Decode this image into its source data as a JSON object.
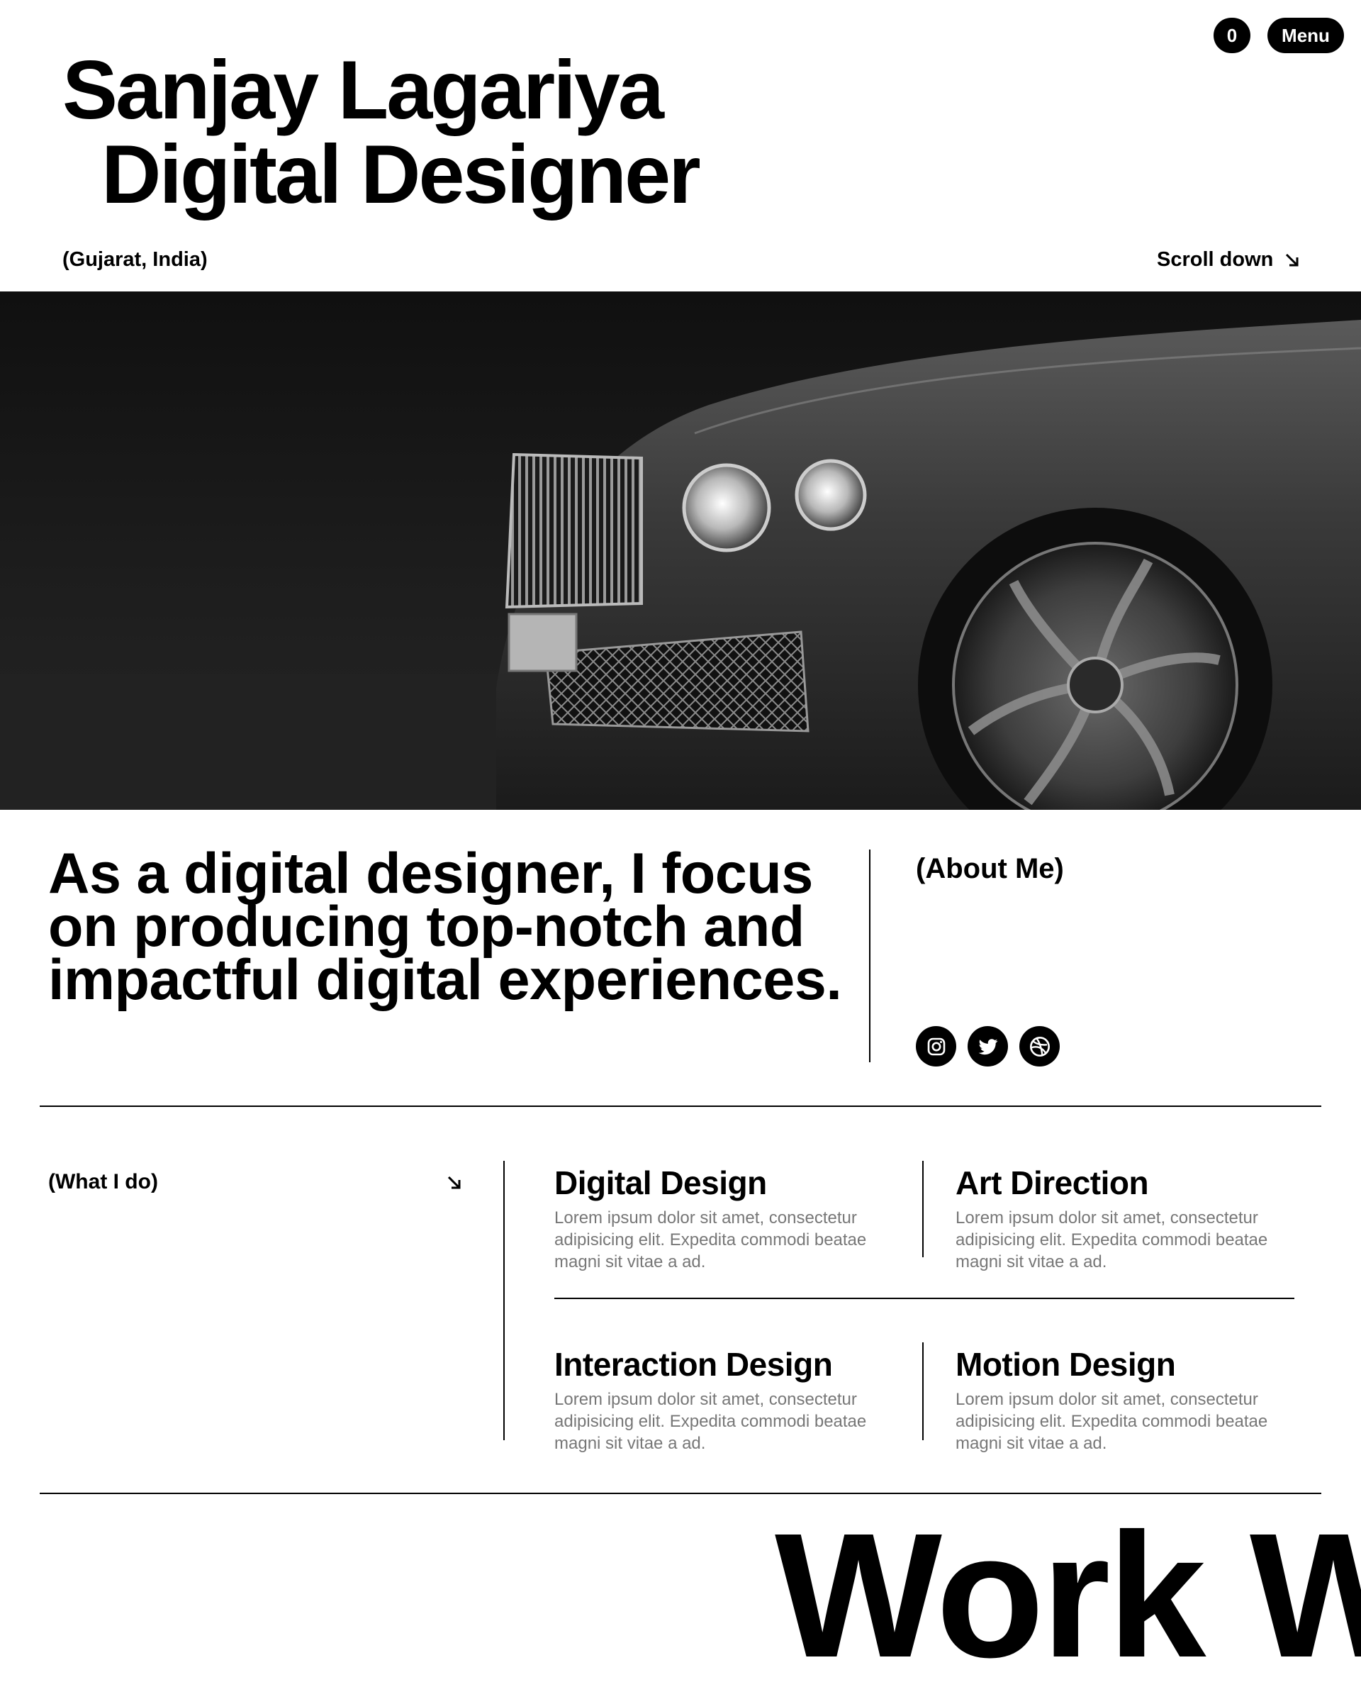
{
  "header": {
    "cart_count": "0",
    "menu_label": "Menu",
    "title_line1": "Sanjay Lagariya",
    "title_line2": "Digital Designer",
    "location": "(Gujarat, India)",
    "scroll_label": "Scroll down"
  },
  "about": {
    "statement": "As a digital designer, I focus on producing top-notch and impactful digital experiences.",
    "label": "(About Me)",
    "socials": [
      "instagram-icon",
      "twitter-icon",
      "dribbble-icon"
    ]
  },
  "services": {
    "label": "(What I do)",
    "items": [
      {
        "title": "Digital Design",
        "desc": "Lorem ipsum dolor sit amet, consectetur adipisicing elit. Expedita commodi beatae magni sit vitae a ad."
      },
      {
        "title": "Art Direction",
        "desc": "Lorem ipsum dolor sit amet, consectetur adipisicing elit. Expedita commodi beatae magni sit vitae a ad."
      },
      {
        "title": "Interaction Design",
        "desc": "Lorem ipsum dolor sit amet, consectetur adipisicing elit. Expedita commodi beatae magni sit vitae a ad."
      },
      {
        "title": "Motion Design",
        "desc": "Lorem ipsum dolor sit amet, consectetur adipisicing elit. Expedita commodi beatae magni sit vitae a ad."
      }
    ]
  },
  "work": {
    "heading": "Work W"
  },
  "colors": {
    "text": "#000000",
    "muted": "#777777",
    "background": "#ffffff"
  }
}
